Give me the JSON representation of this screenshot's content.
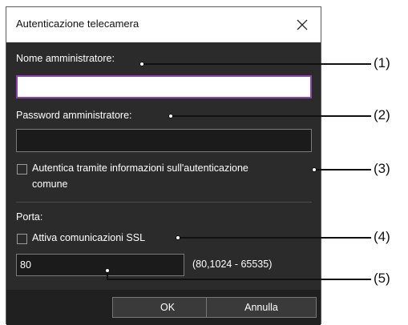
{
  "dialog": {
    "title": "Autenticazione telecamera",
    "close_symbol": "✕"
  },
  "form": {
    "admin_name_label": "Nome amministratore:",
    "admin_name_value": "",
    "admin_password_label": "Password amministratore:",
    "admin_password_value": "",
    "common_auth_label_line1": "Autentica tramite informazioni sull'autenticazione",
    "common_auth_label_line2": "comune",
    "common_auth_checked": false,
    "port_label": "Porta:",
    "ssl_label": "Attiva comunicazioni SSL",
    "ssl_checked": false,
    "port_value": "80",
    "port_range": "(80,1024 - 65535)"
  },
  "buttons": {
    "ok_label": "OK",
    "cancel_label": "Annulla"
  },
  "callouts": [
    "(1)",
    "(2)",
    "(3)",
    "(4)",
    "(5)"
  ],
  "colors": {
    "dialog_bg": "#2b2b2b",
    "focus_border": "#8e44ad"
  },
  "icons": {
    "close": "close-icon",
    "checkbox": "checkbox-icon"
  }
}
